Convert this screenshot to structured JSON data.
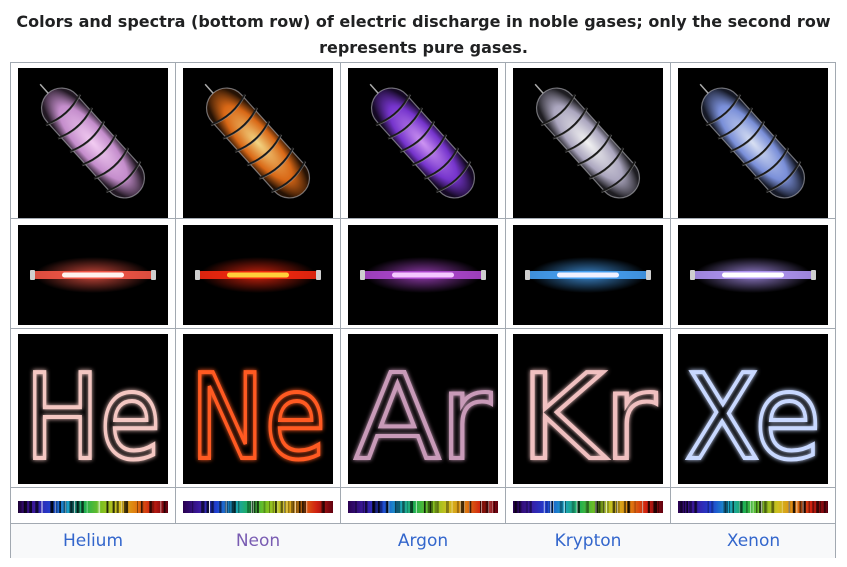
{
  "caption": "Colors and spectra (bottom row) of electric discharge in noble gases; only the second row represents pure gases.",
  "gases": [
    {
      "name": "Helium",
      "symbol": "He",
      "glow": "#e7a6f0",
      "core": "#ffd7ff",
      "tube": "#ff5a4a",
      "tubecore": "#fff2ee",
      "letters": "#f4c7c2"
    },
    {
      "name": "Neon",
      "symbol": "Ne",
      "glow": "#ff7a1a",
      "core": "#ffe08a",
      "tube": "#ff2a10",
      "tubecore": "#ffcf3a",
      "letters": "#ff5a20"
    },
    {
      "name": "Argon",
      "symbol": "Ar",
      "glow": "#8a3df0",
      "core": "#d89cff",
      "tube": "#b64ad8",
      "tubecore": "#f4c8ff",
      "letters": "#c89ab8"
    },
    {
      "name": "Krypton",
      "symbol": "Kr",
      "glow": "#c9c3e0",
      "core": "#ffffff",
      "tube": "#4aa8ff",
      "tubecore": "#f0f0ff",
      "letters": "#f0c0c0"
    },
    {
      "name": "Xenon",
      "symbol": "Xe",
      "glow": "#8fa8ff",
      "core": "#e4ecff",
      "tube": "#b89cff",
      "tubecore": "#ffffff",
      "letters": "#c8d8ff"
    }
  ],
  "link_colors": {
    "unvisited": "#3366cc",
    "visited": "#795cb2"
  }
}
